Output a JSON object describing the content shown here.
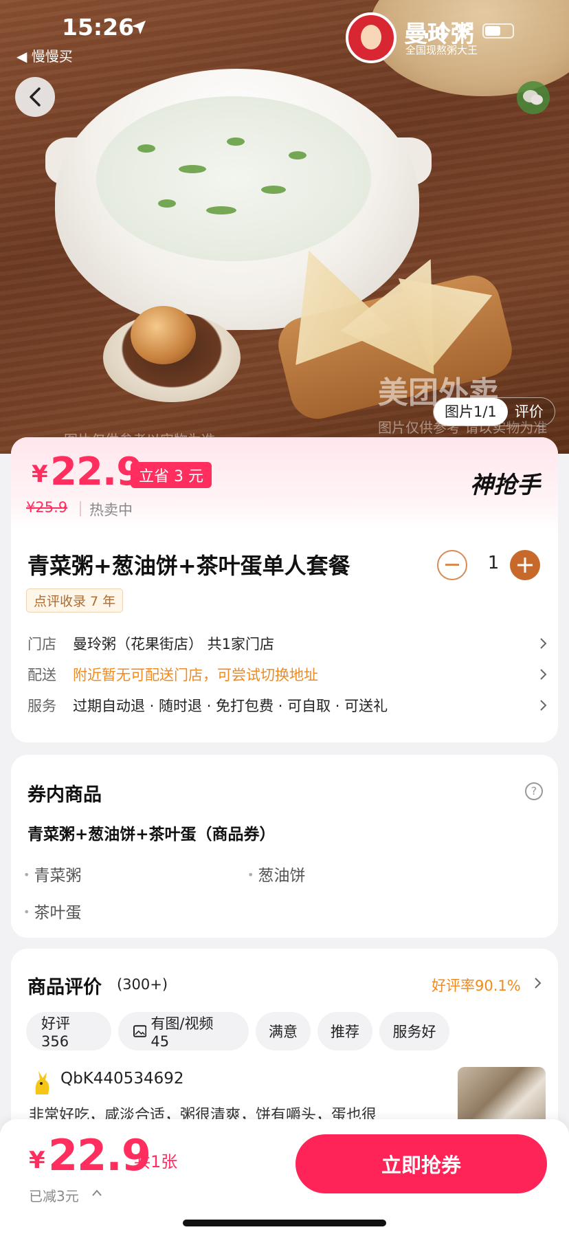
{
  "status_bar": {
    "time": "15:26",
    "back_app": "◀ 慢慢买"
  },
  "brand": {
    "name": "曼玲粥",
    "slogan": "全国现熬粥大王"
  },
  "hero": {
    "watermark": "美团外卖",
    "disclaimer": "图片仅供参考 请以实物为准",
    "disclaimer_left": "图片仅供参考以实物为准",
    "tabs": [
      "图片1/1",
      "评价"
    ]
  },
  "price": {
    "yen": "¥",
    "current": "22.9",
    "save_badge": "立省 3 元",
    "original": "¥25.9",
    "status": "热卖中",
    "program_logo": "神抢手"
  },
  "product": {
    "title": "青菜粥+葱油饼+茶叶蛋单人套餐",
    "quantity": "1",
    "tag": "点评收录 7 年"
  },
  "info_rows": [
    {
      "label": "门店",
      "value": "曼玲粥（花果街店）  共1家门店"
    },
    {
      "label": "配送",
      "value": "附近暂无可配送门店，可尝试切换地址"
    },
    {
      "label": "服务",
      "value": "过期自动退 · 随时退 · 免打包费 · 可自取 · 可送礼"
    }
  ],
  "voucher": {
    "title": "券内商品",
    "name": "青菜粥+葱油饼+茶叶蛋（商品券）",
    "items": [
      "青菜粥",
      "葱油饼",
      "茶叶蛋"
    ]
  },
  "reviews": {
    "title": "商品评价",
    "count": "(300+)",
    "good_rate": "好评率90.1%",
    "chips": [
      "好评 356",
      "有图/视频 45",
      "满意",
      "推荐",
      "服务好"
    ],
    "first_review": {
      "user": "QbK440534692",
      "text": "非常好吃，咸淡合适，粥很清爽，饼有嚼头，蛋也很"
    }
  },
  "bottom_bar": {
    "yen": "¥",
    "price": "22.9",
    "count": "共1张",
    "reduced": "已减3元",
    "buy_button": "立即抢券"
  },
  "colors": {
    "accent": "#ff2e5e",
    "orange": "#ef8a20",
    "qty_plus": "#c8692c"
  }
}
